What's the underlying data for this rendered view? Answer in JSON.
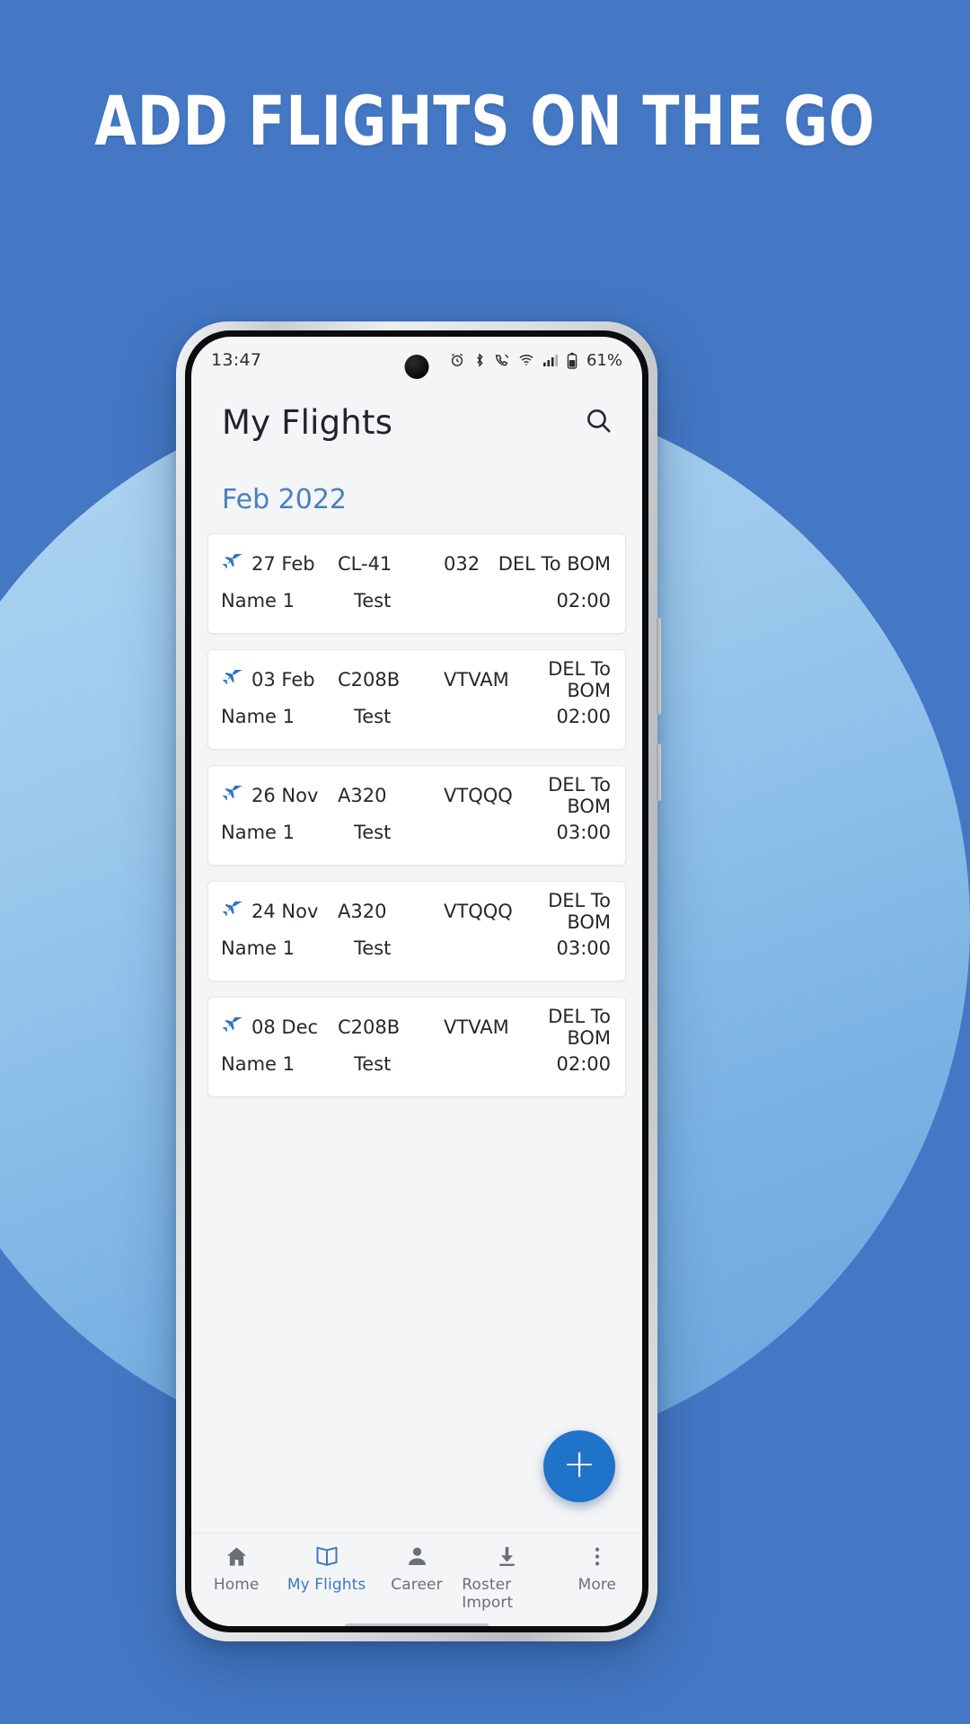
{
  "poster": {
    "headline": "ADD FLIGHTS ON THE GO",
    "background_color": "#4478c4",
    "circle_color": "#9fcdef"
  },
  "statusbar": {
    "time": "13:47",
    "battery_percent": "61%",
    "icons": [
      "alarm-icon",
      "bluetooth-icon",
      "call-mute-icon",
      "wifi-icon",
      "signal-icon",
      "battery-icon"
    ]
  },
  "header": {
    "title": "My Flights",
    "search_icon": "search-icon"
  },
  "section": {
    "month_label": "Feb 2022",
    "accent_color": "#4a7fc0"
  },
  "flights": [
    {
      "icon": "jet-plane-icon",
      "date": "27 Feb",
      "aircraft_type": "CL-41",
      "registration": "032",
      "route": "DEL To BOM",
      "crew_name": "Name 1",
      "note": "Test",
      "duration": "02:00"
    },
    {
      "icon": "jet-plane-icon",
      "date": "03 Feb",
      "aircraft_type": "C208B",
      "registration": "VTVAM",
      "route": "DEL To BOM",
      "crew_name": "Name 1",
      "note": "Test",
      "duration": "02:00"
    },
    {
      "icon": "jet-plane-icon",
      "date": "26 Nov",
      "aircraft_type": "A320",
      "registration": "VTQQQ",
      "route": "DEL To BOM",
      "crew_name": "Name 1",
      "note": "Test",
      "duration": "03:00"
    },
    {
      "icon": "jet-plane-icon",
      "date": "24 Nov",
      "aircraft_type": "A320",
      "registration": "VTQQQ",
      "route": "DEL To BOM",
      "crew_name": "Name 1",
      "note": "Test",
      "duration": "03:00"
    },
    {
      "icon": "jet-plane-icon",
      "date": "08 Dec",
      "aircraft_type": "C208B",
      "registration": "VTVAM",
      "route": "DEL To BOM",
      "crew_name": "Name 1",
      "note": "Test",
      "duration": "02:00"
    }
  ],
  "fab": {
    "label": "+",
    "icon": "plus-icon",
    "color": "#1f73c8"
  },
  "bottom_nav": {
    "active_color": "#3a7bbf",
    "inactive_color": "#6b7076",
    "items": [
      {
        "label": "Home",
        "icon": "home-icon",
        "active": false
      },
      {
        "label": "My Flights",
        "icon": "book-icon",
        "active": true
      },
      {
        "label": "Career",
        "icon": "person-icon",
        "active": false
      },
      {
        "label": "Roster Import",
        "icon": "download-icon",
        "active": false
      },
      {
        "label": "More",
        "icon": "dots-vertical-icon",
        "active": false
      }
    ]
  }
}
